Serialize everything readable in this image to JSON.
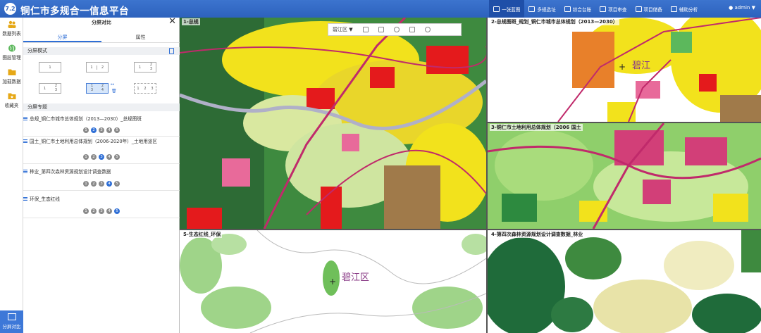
{
  "app": {
    "title": "铜仁市多规合一信息平台",
    "logo_text": "7.2"
  },
  "topnav": [
    {
      "label": "一张蓝图",
      "active": true
    },
    {
      "label": "多规选址"
    },
    {
      "label": "综合台账"
    },
    {
      "label": "项目审查"
    },
    {
      "label": "项目储备"
    },
    {
      "label": "辅助分析"
    }
  ],
  "user": {
    "name": "admin",
    "caret": "▼"
  },
  "leftbar": [
    {
      "label": "数据列表"
    },
    {
      "label": "图层管理"
    },
    {
      "label": "加载数据"
    },
    {
      "label": "收藏夹"
    }
  ],
  "leftbar_bottom": "分屏对比",
  "panel": {
    "title": "分屏对比",
    "close": "✕",
    "tabs": [
      "分屏",
      "属性"
    ],
    "mode_label": "分屏模式",
    "theme_label": "分屏专题",
    "layout_nums": {
      "one": "1",
      "two": [
        "1",
        "2"
      ],
      "three": [
        "1",
        "2",
        "3"
      ],
      "four_a": [
        "1",
        "2",
        "3"
      ],
      "four_b": [
        "1",
        "2",
        "3",
        "4"
      ],
      "four_c": [
        "1",
        "2",
        "3"
      ]
    },
    "themes": [
      {
        "title": "总规_铜仁市城市总体规划（2013—2030）_总规图斑",
        "nums": [
          "1",
          "2",
          "3",
          "4",
          "5"
        ],
        "active": 2
      },
      {
        "title": "国土_铜仁市土地利用总体规划（2006-2020年）_土地用途区",
        "nums": [
          "1",
          "2",
          "3",
          "4",
          "5"
        ],
        "active": 3
      },
      {
        "title": "林业_第四次森林资源规划设计调查数据",
        "nums": [
          "1",
          "2",
          "3",
          "4",
          "5"
        ],
        "active": 4
      },
      {
        "title": "环保_生态红线",
        "nums": [
          "1",
          "2",
          "3",
          "4",
          "5"
        ],
        "active": 5
      }
    ]
  },
  "toolbar": {
    "district": "碧江区",
    "caret": "▼"
  },
  "maps": {
    "m1": {
      "title": "1-总规"
    },
    "m2": {
      "title": "2-总规图斑_规划_铜仁市城市总体规划（2013—2030）",
      "place": "碧江"
    },
    "m3": {
      "title": "3-铜仁市土地利用总体规划（2006 国土"
    },
    "m4": {
      "title": "4-第四次森林资源规划设计调查数据_林业"
    },
    "m5": {
      "title": "5-生态红线_环保",
      "place": "碧江区"
    }
  },
  "colors": {
    "topbar": "#2f64be",
    "accent": "#2f6fd6",
    "zoning_yellow": "#f2e21c",
    "zoning_red": "#e41a1c",
    "forest_green": "#1f6b3a",
    "light_green": "#8fcf6b",
    "magenta": "#c02a6b",
    "pink": "#e86a9a"
  }
}
